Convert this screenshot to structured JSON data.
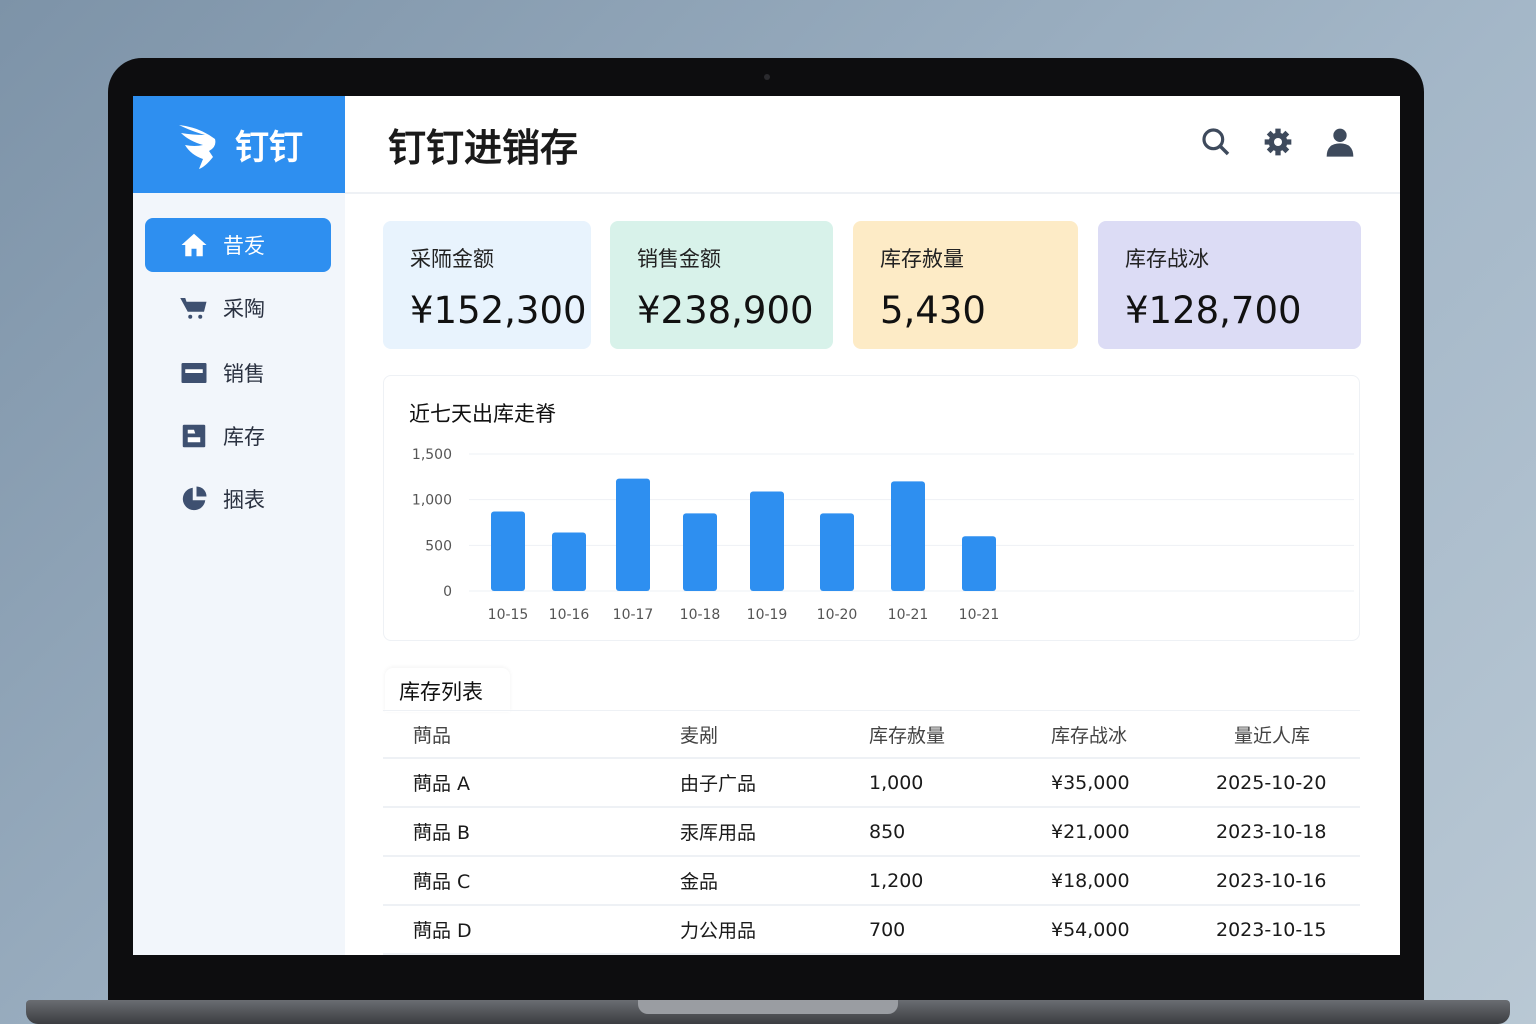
{
  "app": {
    "logo_text": "钉钉",
    "title": "钉钉进销存"
  },
  "sidebar": {
    "items": [
      {
        "label": "昔叐",
        "icon": "home-icon"
      },
      {
        "label": "采陶",
        "icon": "cart-icon"
      },
      {
        "label": "销售",
        "icon": "calendar-icon"
      },
      {
        "label": "库存",
        "icon": "box-icon"
      },
      {
        "label": "捆表",
        "icon": "pie-chart-icon"
      }
    ]
  },
  "header": {
    "icons": [
      "search-icon",
      "gear-icon",
      "user-icon"
    ]
  },
  "cards": [
    {
      "label": "采陑金额",
      "value": "¥152,300",
      "color": "#e8f3fd"
    },
    {
      "label": "销售金额",
      "value": "¥238,900",
      "color": "#d8f2ea"
    },
    {
      "label": "库存赦量",
      "value": "5,430",
      "color": "#fdebc6"
    },
    {
      "label": "库存战冰",
      "value": "¥128,700",
      "color": "#dcdcf5"
    }
  ],
  "chart_data": {
    "type": "bar",
    "title": "近七天出库走脊",
    "categories": [
      "10-15",
      "10-16",
      "10-17",
      "10-18",
      "10-19",
      "10-20",
      "10-21",
      "10-21"
    ],
    "values": [
      870,
      640,
      1230,
      850,
      1090,
      850,
      1200,
      600
    ],
    "yticks": [
      "0",
      "500",
      "1,000",
      "1,500"
    ],
    "ylim": [
      0,
      1500
    ],
    "color": "#2e8ff0",
    "grid": true
  },
  "table": {
    "title": "库存列表",
    "headers": [
      "蔄品",
      "麦剐",
      "库存赦量",
      "库存战冰",
      "量近人库"
    ],
    "rows": [
      [
        "蔄品 A",
        "由子广品",
        "1,000",
        "¥35,000",
        "2025-10-20"
      ],
      [
        "蔄品 B",
        "汞厍用品",
        "850",
        "¥21,000",
        "2023-10-18"
      ],
      [
        "蔄品 C",
        "金品",
        "1,200",
        "¥18,000",
        "2023-10-16"
      ],
      [
        "蔄品 D",
        "力公用品",
        "700",
        "¥54,000",
        "2023-10-15"
      ]
    ]
  }
}
